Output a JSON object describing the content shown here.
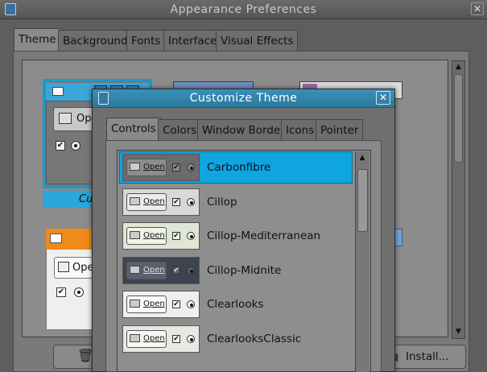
{
  "main_window": {
    "title": "Appearance Preferences",
    "close_glyph": "✕",
    "tabs": [
      "Theme",
      "Background",
      "Fonts",
      "Interface",
      "Visual Effects"
    ],
    "active_tab": "Theme",
    "selected_theme_label_partial": "Cu",
    "thumb_open_partial": "Ope",
    "thumb_open_partial_2": "Ope",
    "buttons": {
      "install_label": "Install..."
    }
  },
  "dialog": {
    "title": "Customize Theme",
    "close_glyph": "✕",
    "tabs": [
      "Controls",
      "Colors",
      "Window Border",
      "Icons",
      "Pointer"
    ],
    "active_tab": "Controls",
    "preview_button_label": "Open",
    "themes": [
      {
        "name": "Carbonfibre",
        "selected": true,
        "preview_bg": "#6b6b6b",
        "btn_bg": "#8c8c8c",
        "text": "#111"
      },
      {
        "name": "Cillop",
        "selected": false,
        "preview_bg": "#d8d8d8",
        "btn_bg": "#ececec",
        "text": "#111"
      },
      {
        "name": "Cillop-Mediterranean",
        "selected": false,
        "preview_bg": "#dfe6d6",
        "btn_bg": "#f0f4e8",
        "text": "#111"
      },
      {
        "name": "Cillop-Midnite",
        "selected": false,
        "preview_bg": "#3e4450",
        "btn_bg": "#5a606c",
        "text": "#ddd"
      },
      {
        "name": "Clearlooks",
        "selected": false,
        "preview_bg": "#efefef",
        "btn_bg": "#fafafa",
        "text": "#111"
      },
      {
        "name": "ClearlooksClassic",
        "selected": false,
        "preview_bg": "#e9e7e2",
        "btn_bg": "#f7f6f3",
        "text": "#111"
      }
    ]
  },
  "colors": {
    "selection": "#0ea5e0",
    "dialog_titlebar": "#2a7aa0",
    "orange_theme": "#f08b1a"
  },
  "icons": [
    "window-icon",
    "close-icon",
    "folder-icon",
    "trash-icon",
    "install-icon",
    "scroll-up-icon",
    "scroll-down-icon"
  ]
}
